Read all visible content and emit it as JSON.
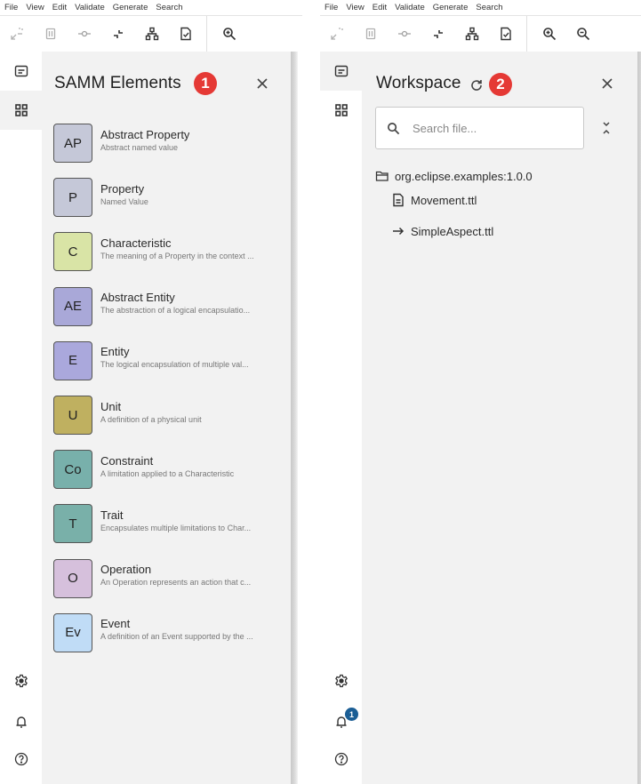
{
  "menu": [
    "File",
    "View",
    "Edit",
    "Validate",
    "Generate",
    "Search"
  ],
  "toolbar": {
    "buttons": [
      {
        "icon": "collapse-expand-icon",
        "label": "Expand/Collapse",
        "enabled": false
      },
      {
        "icon": "delete-icon",
        "label": "Delete",
        "enabled": false
      },
      {
        "icon": "connect-icon",
        "label": "Connect",
        "enabled": false
      },
      {
        "icon": "format-icon",
        "label": "Format",
        "enabled": true
      },
      {
        "icon": "hierarchy-icon",
        "label": "Layout",
        "enabled": true
      },
      {
        "icon": "validate-file-icon",
        "label": "Validate",
        "enabled": true
      },
      {
        "icon": "zoom-in-icon",
        "label": "Zoom in",
        "enabled": true
      },
      {
        "icon": "zoom-out-icon",
        "label": "Zoom out",
        "enabled": true
      }
    ]
  },
  "sidebar": {
    "top": [
      {
        "icon": "workspace-folder-icon",
        "label": "Workspace"
      },
      {
        "icon": "elements-grid-icon",
        "label": "SAMM Elements"
      }
    ],
    "bottom": [
      {
        "icon": "settings-gear-icon",
        "label": "Settings"
      },
      {
        "icon": "notifications-bell-icon",
        "label": "Notifications"
      },
      {
        "icon": "help-icon",
        "label": "Help"
      }
    ]
  },
  "left_view": {
    "active_sidebar": "SAMM Elements",
    "title": "SAMM Elements",
    "step_badge": "1",
    "notification_count": null,
    "elements": [
      {
        "abbr": "AP",
        "name": "Abstract Property",
        "desc": "Abstract named value",
        "color": "#c5c8d8"
      },
      {
        "abbr": "P",
        "name": "Property",
        "desc": "Named Value",
        "color": "#c5c8d8"
      },
      {
        "abbr": "C",
        "name": "Characteristic",
        "desc": "The meaning of a Property in the context ...",
        "color": "#d9e4a6"
      },
      {
        "abbr": "AE",
        "name": "Abstract Entity",
        "desc": "The abstraction of a logical encapsulatio...",
        "color": "#a9a8d8"
      },
      {
        "abbr": "E",
        "name": "Entity",
        "desc": "The logical encapsulation of multiple val...",
        "color": "#aaa8dc"
      },
      {
        "abbr": "U",
        "name": "Unit",
        "desc": "A definition of a physical unit",
        "color": "#bfb060"
      },
      {
        "abbr": "Co",
        "name": "Constraint",
        "desc": "A limitation applied to a Characteristic",
        "color": "#78b0ab"
      },
      {
        "abbr": "T",
        "name": "Trait",
        "desc": "Encapsulates multiple limitations to Char...",
        "color": "#79b0a9"
      },
      {
        "abbr": "O",
        "name": "Operation",
        "desc": "An Operation represents an action that c...",
        "color": "#d6c0dc"
      },
      {
        "abbr": "Ev",
        "name": "Event",
        "desc": "A definition of an Event supported by the ...",
        "color": "#c0dcf6"
      }
    ]
  },
  "right_view": {
    "active_sidebar": "Workspace",
    "title": "Workspace",
    "step_badge": "2",
    "notification_count": "1",
    "search": {
      "placeholder": "Search file...",
      "value": ""
    },
    "tree": {
      "namespace": "org.eclipse.examples:1.0.0",
      "files": [
        {
          "name": "Movement.ttl",
          "icon": "file-document-icon"
        },
        {
          "name": "SimpleAspect.ttl",
          "icon": "arrow-right-icon"
        }
      ]
    }
  },
  "colors": {
    "step_badge": "#e53935",
    "notification_badge": "#1b5e95",
    "panel_bg": "#f2f2f2"
  }
}
